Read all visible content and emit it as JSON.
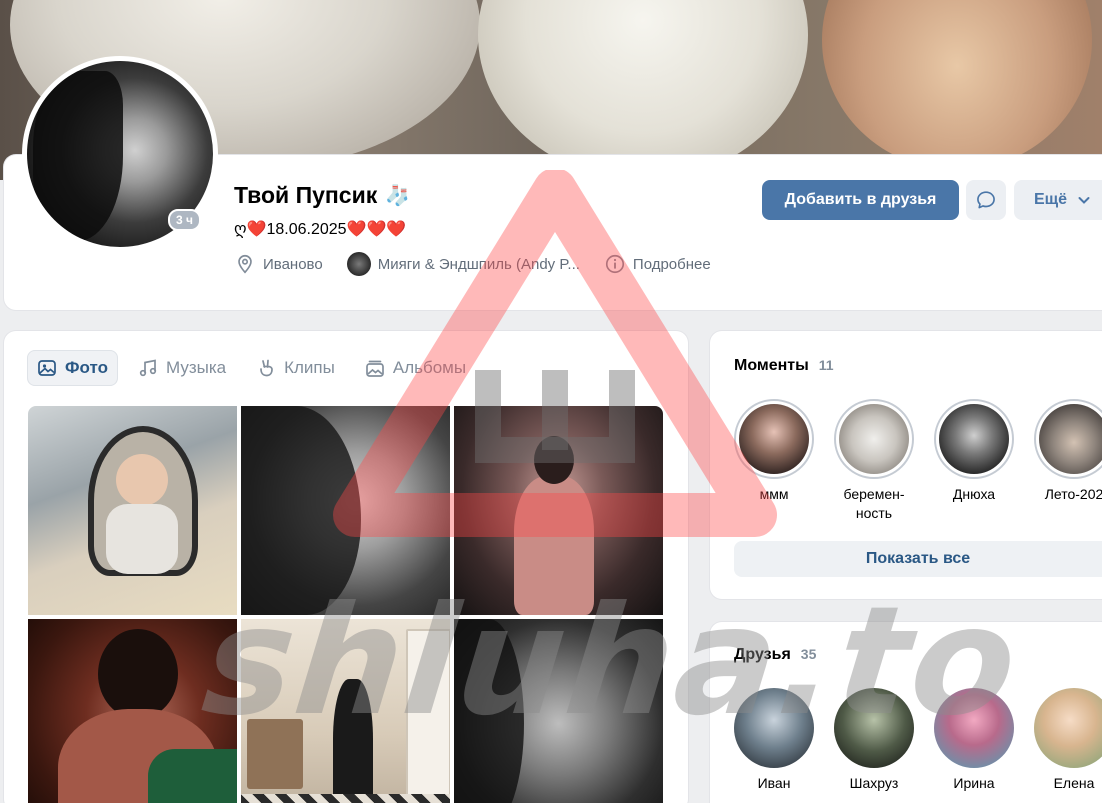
{
  "profile": {
    "name": "Твой Пупсик",
    "name_emoji": "🧦",
    "status": "ღ❤️18.06.2025❤️❤️❤️",
    "online_badge": "3 ч",
    "city": "Иваново",
    "music": "Мияги & Эндшпиль (Andy P...",
    "details_label": "Подробнее"
  },
  "actions": {
    "add_friend": "Добавить в друзья",
    "more": "Ещё"
  },
  "tabs": [
    {
      "label": "Фото",
      "active": true
    },
    {
      "label": "Музыка",
      "active": false
    },
    {
      "label": "Клипы",
      "active": false
    },
    {
      "label": "Альбомы",
      "active": false
    }
  ],
  "moments": {
    "title": "Моменты",
    "count": "11",
    "items": [
      {
        "label": "ммм"
      },
      {
        "label": "беремен-ность"
      },
      {
        "label": "Днюха"
      },
      {
        "label": "Лето-202"
      }
    ],
    "show_all": "Показать все"
  },
  "friends": {
    "title": "Друзья",
    "count": "35",
    "items": [
      {
        "name": "Иван"
      },
      {
        "name": "Шахруз"
      },
      {
        "name": "Ирина"
      },
      {
        "name": "Елена"
      }
    ]
  },
  "watermark": {
    "text": "shluha.to",
    "color": "#ff0000"
  },
  "colors": {
    "accent": "#4a76a8",
    "link": "#2a5885",
    "muted": "#828e9b"
  }
}
